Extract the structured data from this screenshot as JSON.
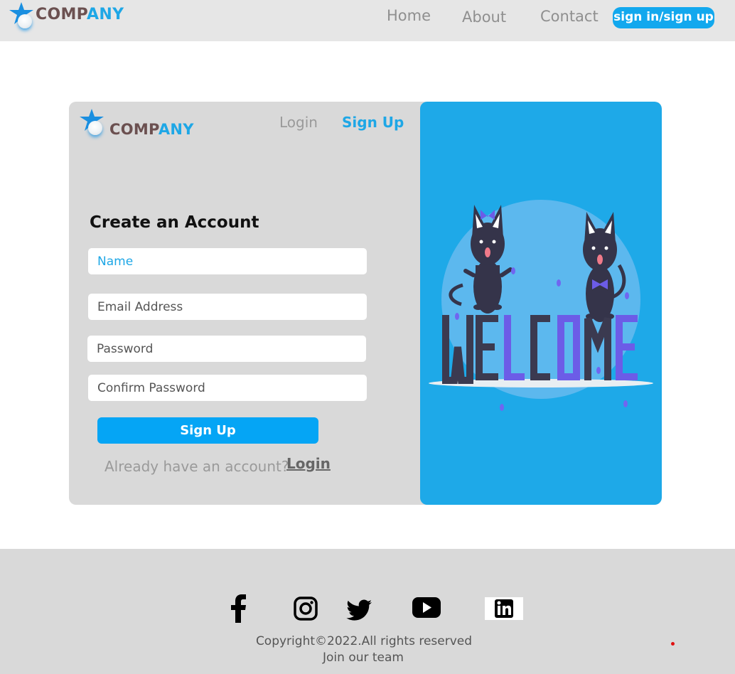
{
  "brand": {
    "part1": "COMP",
    "part2": "ANY",
    "icon": "star-logo-icon"
  },
  "nav": {
    "home": "Home",
    "about": "About",
    "contact": "Contact",
    "signin": "sign in/sign up"
  },
  "card": {
    "tabs": {
      "login": "Login",
      "signup": "Sign Up"
    },
    "title": "Create an Account",
    "fields": {
      "name": "Name",
      "email": "Email Address",
      "password": "Password",
      "confirm": "Confirm Password"
    },
    "submit": "Sign Up",
    "have_account": "Already have an account?",
    "login_link": "Login",
    "illustration": {
      "word": "WELCOME"
    }
  },
  "footer": {
    "social": [
      "facebook-icon",
      "instagram-icon",
      "twitter-icon",
      "youtube-icon",
      "linkedin-icon"
    ],
    "copyright": "Copyright©2022.All rights reserved",
    "join": "Join our team"
  },
  "colors": {
    "accent": "#1ea7e6",
    "button": "#05a5f5",
    "panel": "#1ea9e8",
    "brand_dark": "#6b5050",
    "purple": "#7066f0"
  }
}
